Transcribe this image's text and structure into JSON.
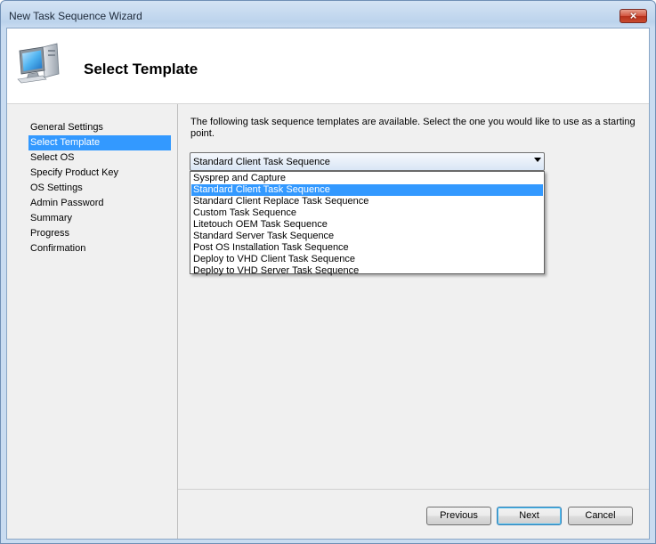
{
  "window": {
    "title": "New Task Sequence Wizard",
    "close_label": "×"
  },
  "header": {
    "title": "Select Template",
    "icon": "computer-icon"
  },
  "nav": {
    "items": [
      {
        "label": "General Settings",
        "selected": false
      },
      {
        "label": "Select Template",
        "selected": true
      },
      {
        "label": "Select OS",
        "selected": false
      },
      {
        "label": "Specify Product Key",
        "selected": false
      },
      {
        "label": "OS Settings",
        "selected": false
      },
      {
        "label": "Admin Password",
        "selected": false
      },
      {
        "label": "Summary",
        "selected": false
      },
      {
        "label": "Progress",
        "selected": false
      },
      {
        "label": "Confirmation",
        "selected": false
      }
    ]
  },
  "content": {
    "description": "The following task sequence templates are available.  Select the one you would like to use as a starting point.",
    "template_select": {
      "value": "Standard Client Task Sequence",
      "options": [
        "Sysprep and Capture",
        "Standard Client Task Sequence",
        "Standard Client Replace Task Sequence",
        "Custom Task Sequence",
        "Litetouch OEM Task Sequence",
        "Standard Server Task Sequence",
        "Post OS Installation Task Sequence",
        "Deploy to VHD Client Task Sequence",
        "Deploy to VHD Server Task Sequence"
      ],
      "highlighted_index": 1
    }
  },
  "buttons": {
    "previous": "Previous",
    "next": "Next",
    "cancel": "Cancel"
  },
  "colors": {
    "selection": "#3399ff",
    "title_bar": "#c9dcf1",
    "close_button": "#c94b2f"
  }
}
